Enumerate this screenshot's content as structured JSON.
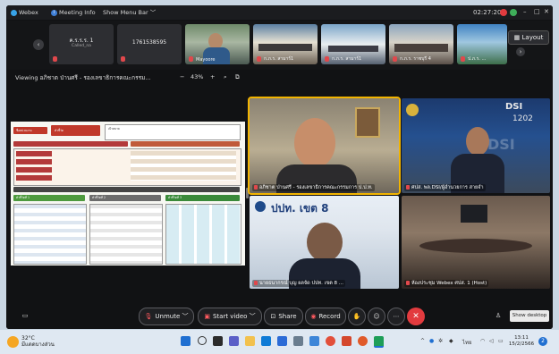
{
  "titlebar": {
    "app_name": "Webex",
    "meeting_info": "Meeting Info",
    "show_menu": "Show Menu Bar",
    "timer": "02:27:20",
    "minimize": "–",
    "maximize": "□",
    "close": "✕"
  },
  "thumbnails": [
    {
      "kind": "text",
      "name": "ค.ร.ร.ร. 1",
      "sub": "Called_na",
      "label": ""
    },
    {
      "kind": "text",
      "name": "1761538595",
      "sub": "",
      "label": ""
    },
    {
      "kind": "video",
      "name": "",
      "sub": "",
      "label": "Mayoore"
    },
    {
      "kind": "video",
      "name": "",
      "sub": "",
      "label": "ก.ภ.ร. สามาร์1"
    },
    {
      "kind": "video",
      "name": "",
      "sub": "",
      "label": "ก.ภ.ร. สามาร์1"
    },
    {
      "kind": "video",
      "name": "",
      "sub": "",
      "label": "ก.ภ.ร. ราชบุรี 4"
    },
    {
      "kind": "video",
      "name": "",
      "sub": "",
      "label": "ป.ภ.ร. ..."
    }
  ],
  "layout_label": "Layout",
  "viewing": {
    "text": "Viewing อภิชาต ป่านศรี - รองเลขาธิการคณะกรรม...",
    "zoom": "43%",
    "minus": "−",
    "plus": "+"
  },
  "slide": {
    "header_labels": [
      "ชื่อหน่วยงาน",
      "ตัวชี้วัด",
      "เป้าหมาย"
    ],
    "section_titles": [
      "ตัวชี้วัดที่ 1",
      "ตัวชี้วัดที่ 2",
      "ตัวชี้วัดที่ 3"
    ]
  },
  "videos": [
    {
      "label": "อภิชาต ป่านศรี - รองเลขาธิการคณะกรรมการ ป.ป.ท.",
      "active": true
    },
    {
      "label": "ศปส. พล.DSI/ผู้อำนวยการ สายจำ",
      "active": false,
      "logo": "DSI",
      "logo_num": "1202"
    },
    {
      "label": "นายธนากรณ์ บุญ ผลจัด ปปท. เขต 8 ...",
      "active": false,
      "banner": "ปปท. เขต 8"
    },
    {
      "label": "ห้องประชุม Webex ศปส. 1 (Host)",
      "active": false
    }
  ],
  "controls": {
    "chat_icon": "chat-icon",
    "unmute": "Unmute",
    "start_video": "Start video",
    "share": "Share",
    "record": "Record",
    "show_desktop": "Show desktop"
  },
  "taskbar": {
    "temp": "32°C",
    "weather": "มีแดดบางส่วน",
    "time": "13:11",
    "date": "15/2/2566",
    "lang": "ไทย",
    "badge": "2"
  },
  "colors": {
    "accent": "#f2b400",
    "end_call": "#e23b3f",
    "muted": "#e0484c"
  }
}
